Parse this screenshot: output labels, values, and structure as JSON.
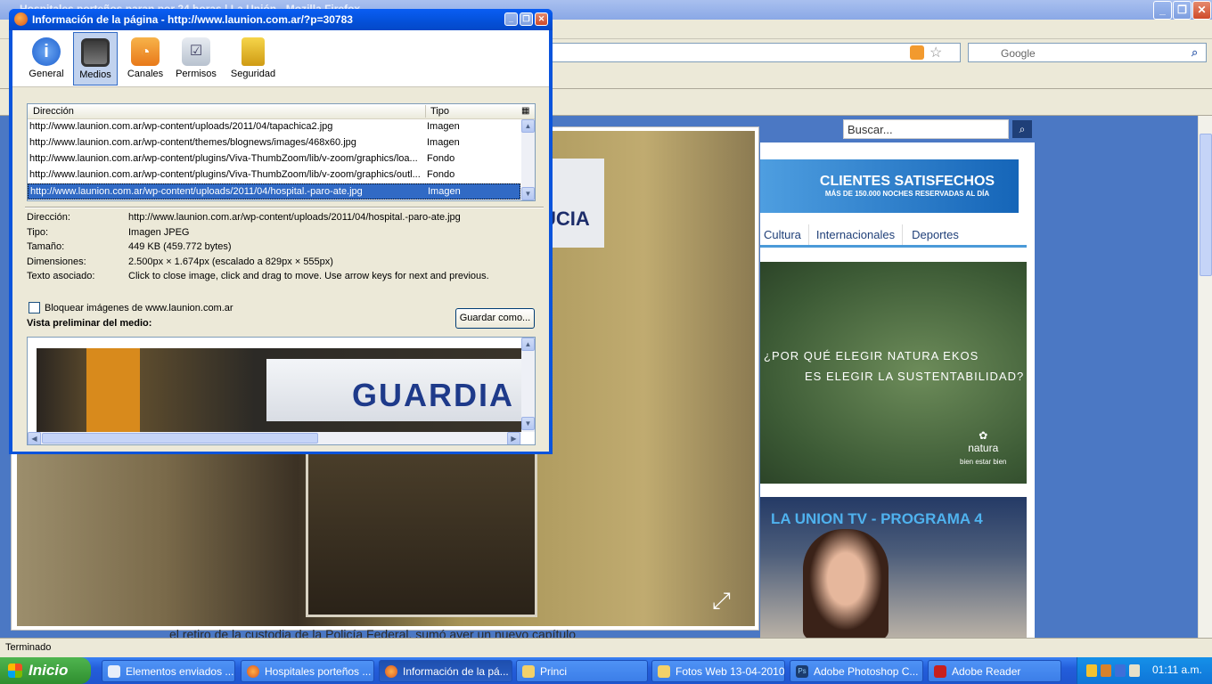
{
  "browser": {
    "title": "Hospitales porteños paran por 24 horas | La Unión - Mozilla Firefox",
    "search_placeholder": "Google"
  },
  "page": {
    "search_placeholder": "Buscar...",
    "banner_title": "CLIENTES SATISFECHOS",
    "banner_sub": "MÁS DE 150.000 NOCHES RESERVADAS AL DÍA",
    "categories": [
      "Cultura",
      "Internacionales",
      "Deportes"
    ],
    "natura_line1": "¿POR QUÉ ELEGIR NATURA EKOS",
    "natura_line2": "ES ELEGIR LA SUSTENTABILIDAD?",
    "natura_logo": "natura",
    "natura_tag": "bien estar bien",
    "tv_title": "LA UNION TV - PROGRAMA 4",
    "photo_sign": "UCIA",
    "caption": "el retiro de la custodia de la Policía Federal, sumó ayer un nuevo capítulo"
  },
  "dialog": {
    "title": "Información de la página - http://www.launion.com.ar/?p=30783",
    "tabs": [
      "General",
      "Medios",
      "Canales",
      "Permisos",
      "Seguridad"
    ],
    "col_address": "Dirección",
    "col_type": "Tipo",
    "rows": [
      {
        "url": "http://www.launion.com.ar/wp-content/uploads/2011/04/tapachica2.jpg",
        "type": "Imagen"
      },
      {
        "url": "http://www.launion.com.ar/wp-content/themes/blognews/images/468x60.jpg",
        "type": "Imagen"
      },
      {
        "url": "http://www.launion.com.ar/wp-content/plugins/Viva-ThumbZoom/lib/v-zoom/graphics/loa...",
        "type": "Fondo"
      },
      {
        "url": "http://www.launion.com.ar/wp-content/plugins/Viva-ThumbZoom/lib/v-zoom/graphics/outl...",
        "type": "Fondo"
      },
      {
        "url": "http://www.launion.com.ar/wp-content/uploads/2011/04/hospital.-paro-ate.jpg",
        "type": "Imagen"
      }
    ],
    "info": {
      "address_label": "Dirección:",
      "address": "http://www.launion.com.ar/wp-content/uploads/2011/04/hospital.-paro-ate.jpg",
      "type_label": "Tipo:",
      "type": "Imagen JPEG",
      "size_label": "Tamaño:",
      "size": "449 KB (459.772 bytes)",
      "dims_label": "Dimensiones:",
      "dims": "2.500px × 1.674px (escalado a 829px × 555px)",
      "alt_label": "Texto asociado:",
      "alt": "Click to close image, click and drag to move. Use arrow keys for next and previous."
    },
    "block_label": "Bloquear imágenes de www.launion.com.ar",
    "save_button": "Guardar como...",
    "preview_label": "Vista preliminar del medio:",
    "preview_sign": "GUARDIA"
  },
  "status": "Terminado",
  "taskbar": {
    "start": "Inicio",
    "items": [
      "Elementos enviados ...",
      "Hospitales porteños ...",
      "Información de la pá...",
      "Princi",
      "Fotos Web 13-04-2010",
      "Adobe Photoshop C...",
      "Adobe Reader"
    ],
    "clock": "01:11 a.m."
  }
}
